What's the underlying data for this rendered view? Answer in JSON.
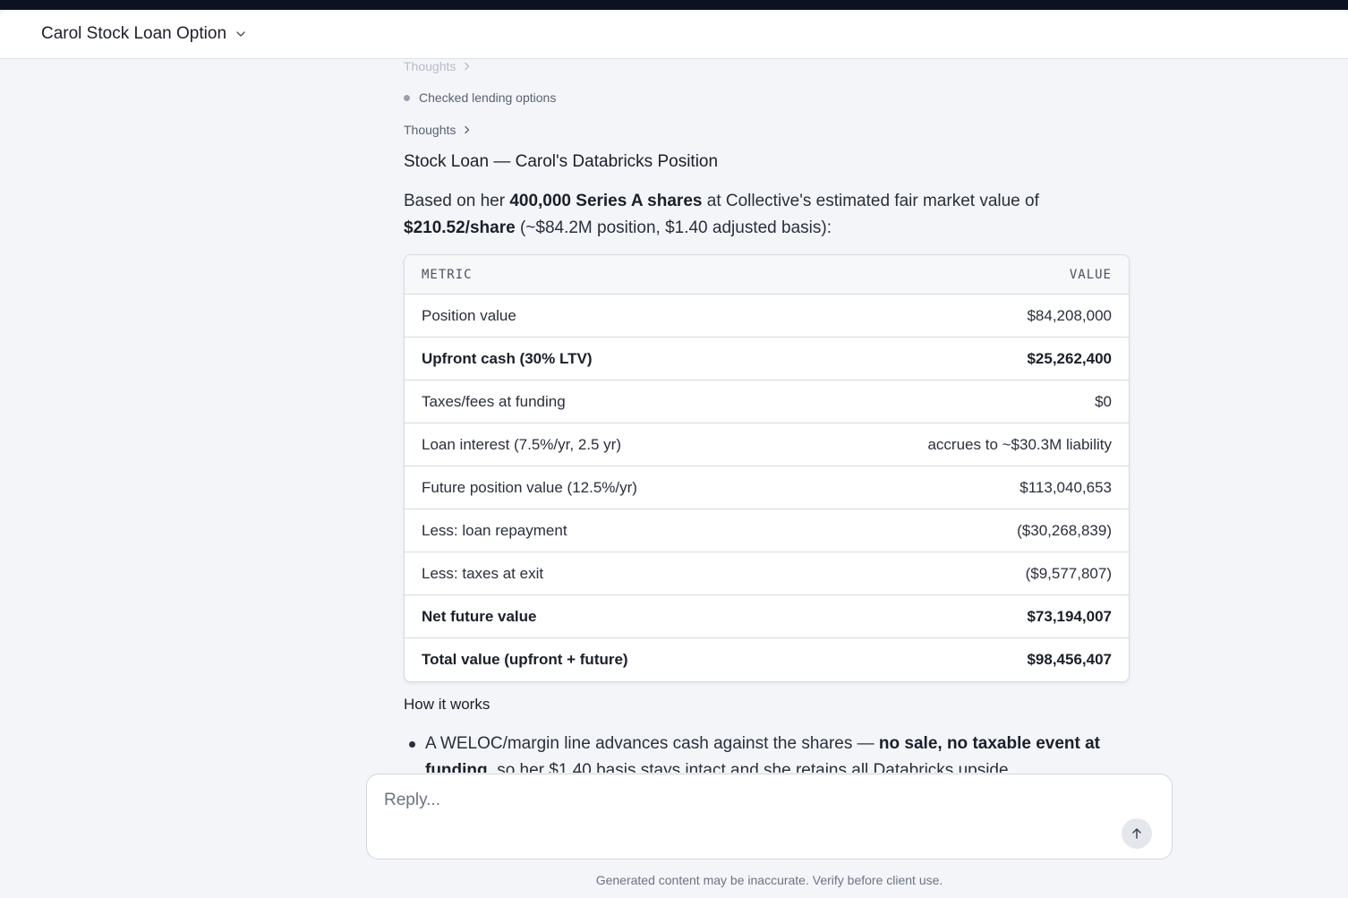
{
  "header": {
    "title": "Carol Stock Loan Option",
    "chevron_icon": "chevron-down-icon"
  },
  "thread": {
    "thoughts_faded": "Thoughts",
    "step": "Checked lending options",
    "thoughts": "Thoughts",
    "heading": "Stock Loan — Carol's Databricks Position",
    "para": {
      "t1": "Based on her ",
      "b1": "400,000 Series A shares",
      "t2": " at Collective's estimated fair market value of ",
      "b2": "$210.52/share",
      "t3": " (~$84.2M position, $1.40 adjusted basis):"
    },
    "table": {
      "headers": [
        "METRIC",
        "VALUE"
      ],
      "rows": [
        {
          "metric": "Position value",
          "value": "$84,208,000"
        },
        {
          "metric": "Upfront cash (30% LTV)",
          "value": "$25,262,400"
        },
        {
          "metric": "Taxes/fees at funding",
          "value": "$0"
        },
        {
          "metric": "Loan interest (7.5%/yr, 2.5 yr)",
          "value": "accrues to ~$30.3M liability"
        },
        {
          "metric": "Future position value (12.5%/yr)",
          "value": "$113,040,653"
        },
        {
          "metric": "Less: loan repayment",
          "value": "($30,268,839)"
        },
        {
          "metric": "Less: taxes at exit",
          "value": "($9,577,807)"
        },
        {
          "metric": "Net future value",
          "value": "$73,194,007"
        },
        {
          "metric": "Total value (upfront + future)",
          "value": "$98,456,407"
        }
      ]
    },
    "how_heading": "How it works",
    "bullet": {
      "t1": "A WELOC/margin line advances cash against the shares — ",
      "b1": "no sale, no taxable event at funding",
      "t2": ", so her $1.40 basis stays intact and she retains all Databricks upside."
    }
  },
  "composer": {
    "placeholder": "Reply...",
    "send_icon": "arrow-up-icon"
  },
  "footer": "Generated content may be inaccurate. Verify before client use."
}
